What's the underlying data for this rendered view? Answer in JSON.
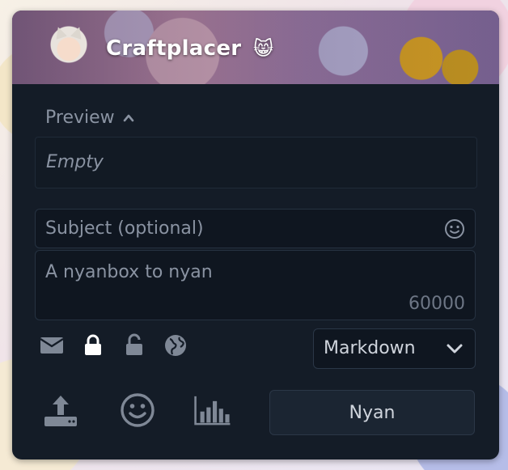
{
  "header": {
    "username": "Craftplacer",
    "emoji": "😸"
  },
  "preview": {
    "toggle_label": "Preview",
    "empty_text": "Empty"
  },
  "compose": {
    "subject_placeholder": "Subject (optional)",
    "body_placeholder": "A nyanbox to nyan",
    "char_remaining": "60000"
  },
  "visibility": {
    "options": [
      "direct",
      "private",
      "unlisted",
      "public"
    ],
    "selected": "private"
  },
  "format": {
    "selected": "Markdown"
  },
  "toolbar": {
    "submit_label": "Nyan"
  },
  "colors": {
    "panel_bg": "#141c27",
    "text_muted": "#8a93a2",
    "text_primary": "#d0d5dd",
    "icon_muted": "#7f8896",
    "icon_active": "#ffffff"
  }
}
